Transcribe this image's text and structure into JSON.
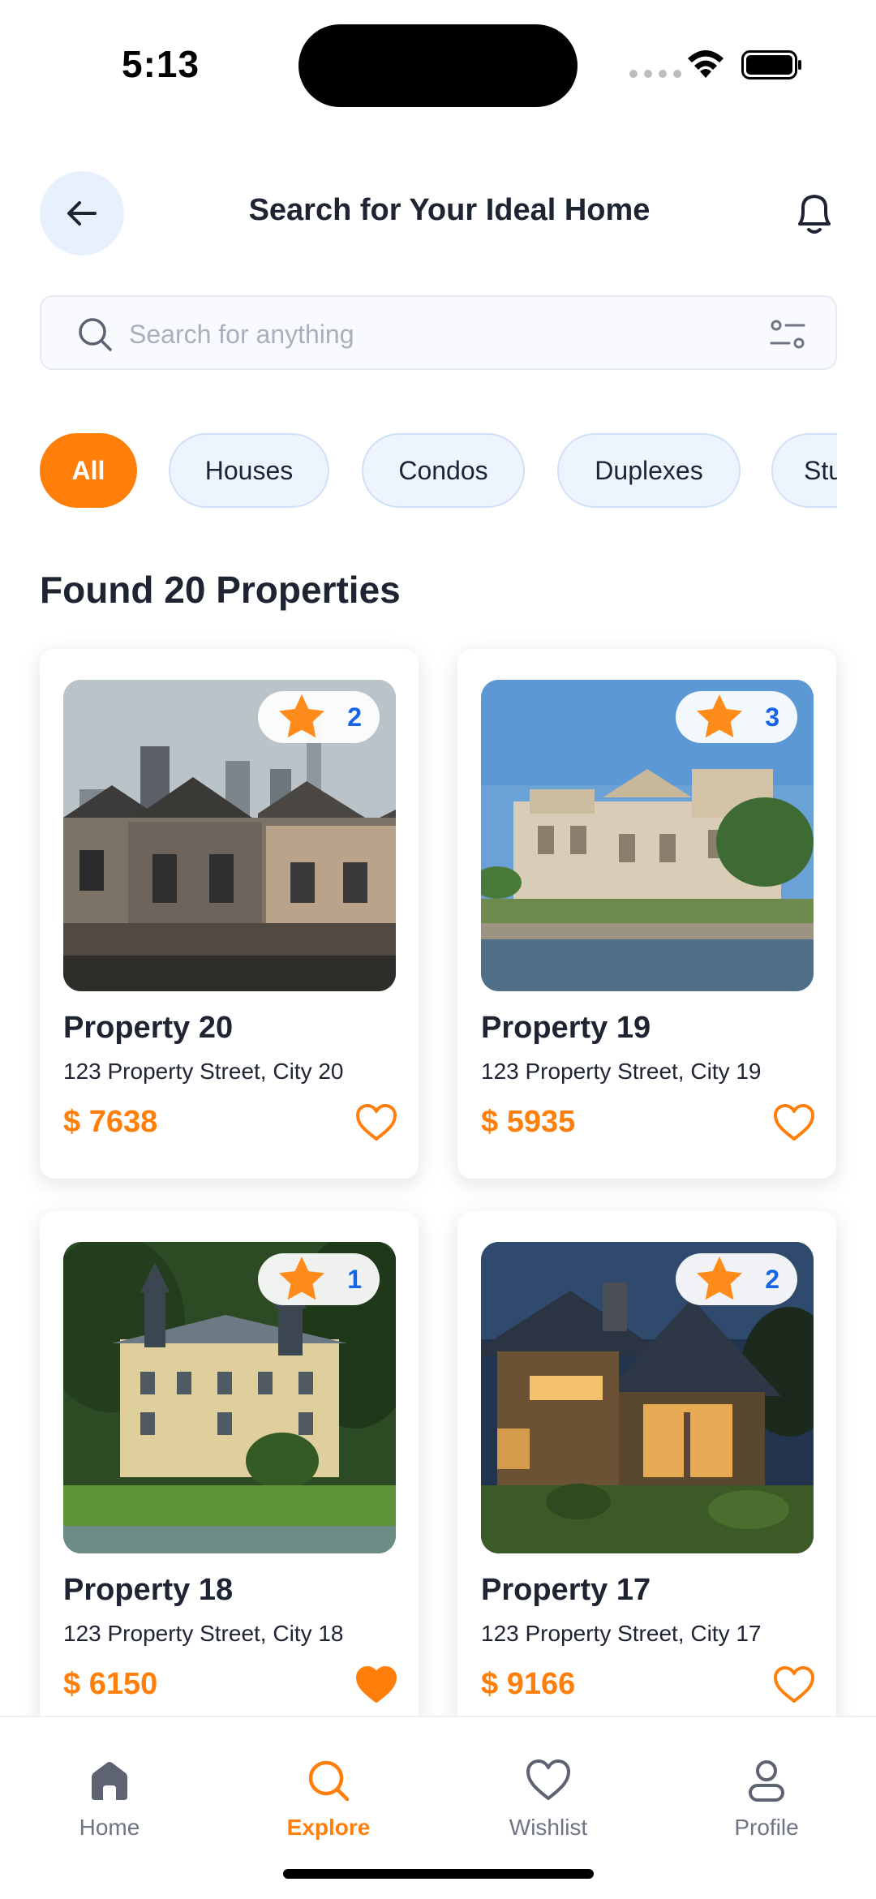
{
  "status_bar": {
    "time": "5:13"
  },
  "header": {
    "title": "Search for Your Ideal Home"
  },
  "search": {
    "placeholder": "Search for anything"
  },
  "categories": [
    {
      "label": "All",
      "active": true
    },
    {
      "label": "Houses",
      "active": false
    },
    {
      "label": "Condos",
      "active": false
    },
    {
      "label": "Duplexes",
      "active": false
    },
    {
      "label": "Studios",
      "active": false
    }
  ],
  "results": {
    "title": "Found 20 Properties"
  },
  "properties": [
    {
      "name": "Property 20",
      "address": "123 Property Street, City 20",
      "price": "$ 7638",
      "rating": "2",
      "favorited": false,
      "image": "victorian-row-houses"
    },
    {
      "name": "Property 19",
      "address": "123 Property Street, City 19",
      "price": "$ 5935",
      "rating": "3",
      "favorited": false,
      "image": "waterfront-palace"
    },
    {
      "name": "Property 18",
      "address": "123 Property Street, City 18",
      "price": "$ 6150",
      "rating": "1",
      "favorited": true,
      "image": "lakeside-villa"
    },
    {
      "name": "Property 17",
      "address": "123 Property Street, City 17",
      "price": "$ 9166",
      "rating": "2",
      "favorited": false,
      "image": "modern-cabin-evening"
    }
  ],
  "bottom_nav": [
    {
      "label": "Home",
      "icon": "home-icon",
      "active": false
    },
    {
      "label": "Explore",
      "icon": "search-icon",
      "active": true
    },
    {
      "label": "Wishlist",
      "icon": "heart-icon",
      "active": false
    },
    {
      "label": "Profile",
      "icon": "user-icon",
      "active": false
    }
  ],
  "colors": {
    "accent": "#ff7f0a",
    "rating_text": "#1565e6",
    "chip_bg": "#eef4fd",
    "back_button_bg": "#e7f0fd",
    "text": "#1f2433"
  }
}
